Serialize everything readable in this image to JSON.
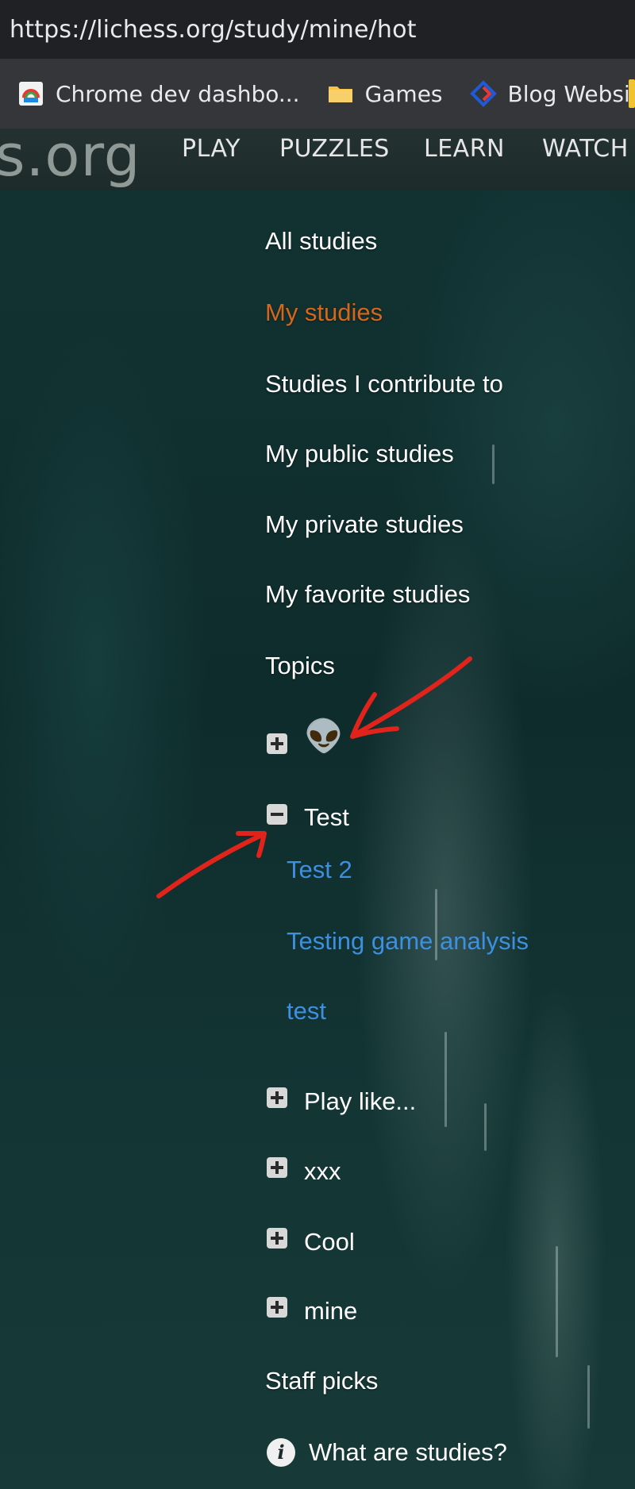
{
  "browser": {
    "url": "https://lichess.org/study/mine/hot",
    "bookmarks": [
      {
        "label": "Chrome dev dashbo...",
        "icon": "chrome-dashboard-icon"
      },
      {
        "label": "Games",
        "icon": "folder-icon"
      },
      {
        "label": "Blog Website",
        "icon": "blog-site-icon"
      }
    ]
  },
  "site": {
    "logo_fragment": "s.org",
    "nav": [
      "PLAY",
      "PUZZLES",
      "LEARN",
      "WATCH"
    ]
  },
  "menu": {
    "all_studies": "All studies",
    "my_studies": "My studies",
    "contribute": "Studies I contribute to",
    "public": "My public studies",
    "private": "My private studies",
    "favorite": "My favorite studies",
    "topics": "Topics",
    "topic_groups": [
      {
        "label": "👽",
        "expanded": false
      },
      {
        "label": "Test",
        "expanded": true,
        "children": [
          "Test 2",
          "Testing game analysis",
          "test"
        ]
      },
      {
        "label": "Play like...",
        "expanded": false
      },
      {
        "label": "xxx",
        "expanded": false
      },
      {
        "label": "Cool",
        "expanded": false
      },
      {
        "label": "mine",
        "expanded": false
      }
    ],
    "staff_picks": "Staff picks",
    "what_are_studies": "What are studies?"
  },
  "colors": {
    "active": "#d4671c",
    "link": "#3d8fe0",
    "annotation": "#e0231b"
  }
}
